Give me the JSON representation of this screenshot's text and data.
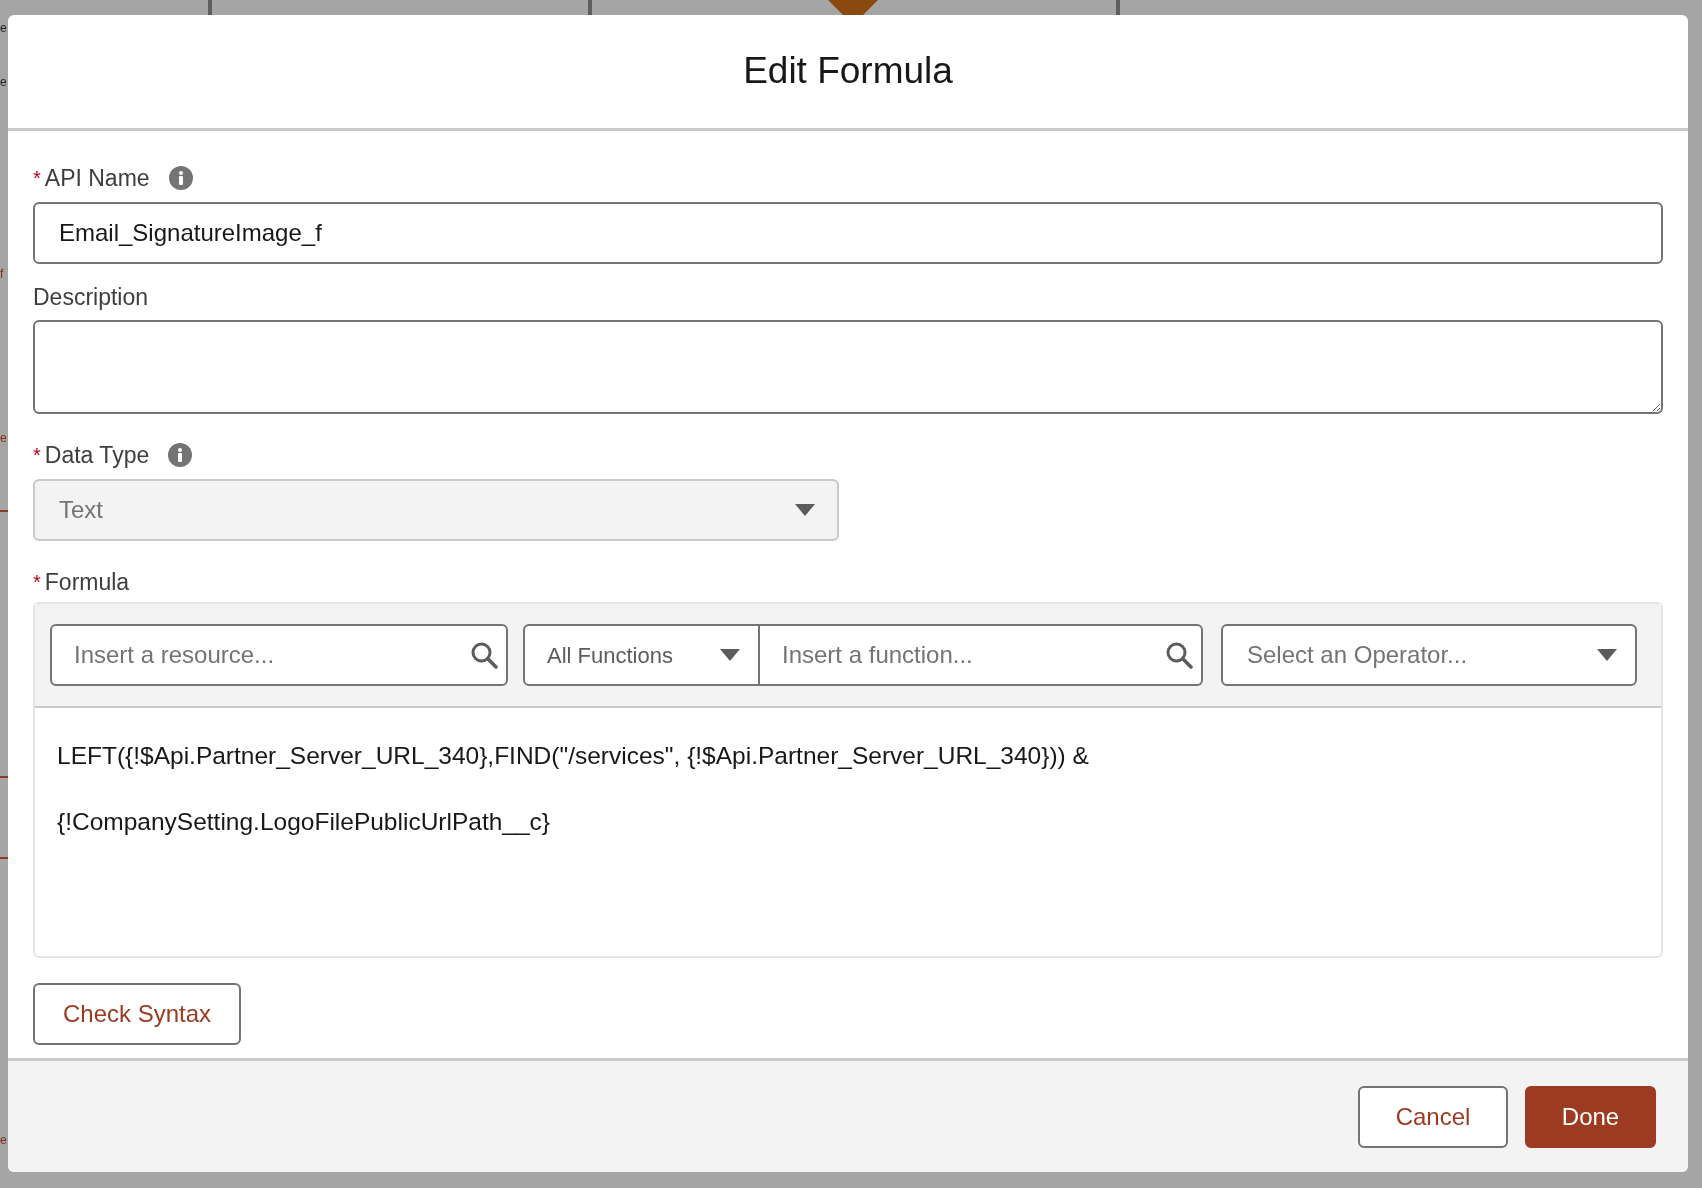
{
  "background_fragments": [
    {
      "text": "e",
      "kind": "dark"
    },
    {
      "text": "e",
      "kind": "dark"
    },
    {
      "text": "f",
      "kind": "link"
    },
    {
      "text": "e",
      "kind": "link"
    },
    {
      "text": "e",
      "kind": "link"
    }
  ],
  "dialog": {
    "title": "Edit Formula"
  },
  "api_name": {
    "label": "API Name",
    "required": true,
    "required_mark": "*",
    "value": "Email_SignatureImage_f"
  },
  "description": {
    "label": "Description"
  },
  "data_type": {
    "label": "Data Type",
    "required": true,
    "required_mark": "*",
    "value": "Text",
    "disabled": true
  },
  "formula": {
    "label": "Formula",
    "required": true,
    "required_mark": "*",
    "resource_search": {
      "placeholder": "Insert a resource..."
    },
    "function_category": {
      "value": "All Functions"
    },
    "function_search": {
      "placeholder": "Insert a function..."
    },
    "operator_select": {
      "placeholder": "Select an Operator..."
    },
    "lines": [
      "LEFT({!$Api.Partner_Server_URL_340},FIND(\"/services\", {!$Api.Partner_Server_URL_340})) &",
      "{!CompanySetting.LogoFilePublicUrlPath__c}"
    ]
  },
  "check_button": "Check Syntax",
  "footer_buttons": [
    {
      "label": "Cancel",
      "kind": "neutral"
    },
    {
      "label": "Done",
      "kind": "brand"
    }
  ]
}
